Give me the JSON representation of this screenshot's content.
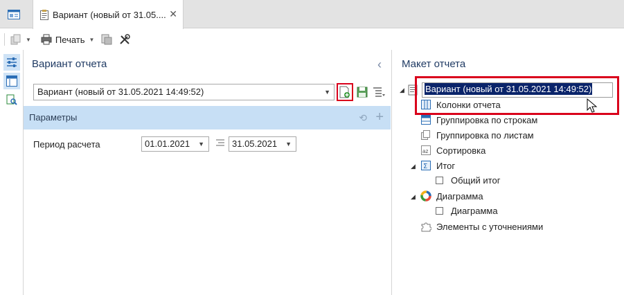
{
  "tabs": {
    "home_icon": "home-window-icon",
    "document_tab_title": "Вариант (новый от 31.05....",
    "close_glyph": "✕"
  },
  "toolbar": {
    "print_label": "Печать"
  },
  "left_pane": {
    "title": "Вариант отчета",
    "variant_value": "Вариант (новый от 31.05.2021 14:49:52)",
    "params_label": "Параметры",
    "period_label": "Период расчета",
    "date_from": "01.01.2021",
    "date_to": "31.05.2021"
  },
  "right_pane": {
    "title": "Макет отчета",
    "root_item": "Вариант (новый от 31.05.2021 14:49:52)",
    "items": [
      "Колонки отчета",
      "Группировка по строкам",
      "Группировка по листам",
      "Сортировка",
      "Итог",
      "Общий итог",
      "Диаграмма",
      "Диаграмма",
      "Элементы с уточнениями"
    ]
  },
  "colors": {
    "accent_blue": "#c7dff5",
    "highlight_red": "#d9001b",
    "selection": "#0a246a",
    "title_blue": "#1f3a63"
  }
}
